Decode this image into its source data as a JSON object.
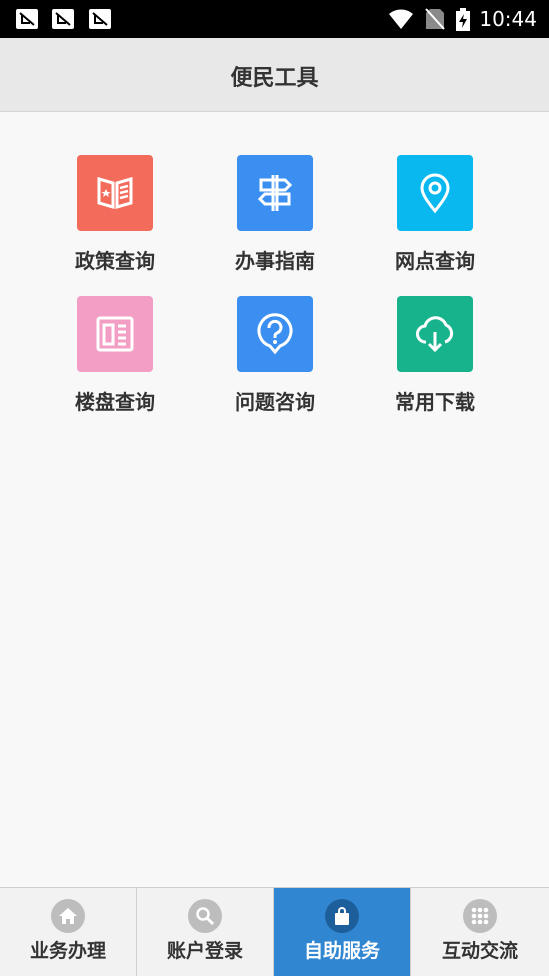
{
  "status_bar": {
    "time": "10:44",
    "notification_icons": [
      "notification-icon",
      "notification-icon",
      "notification-icon"
    ],
    "system_icons": [
      "wifi-icon",
      "no-sim-icon",
      "battery-charging-icon"
    ]
  },
  "header": {
    "title": "便民工具"
  },
  "tools": [
    {
      "label": "政策查询",
      "icon": "policy-book-icon",
      "color": "#f26b5b"
    },
    {
      "label": "办事指南",
      "icon": "signpost-icon",
      "color": "#3b8ff0"
    },
    {
      "label": "网点查询",
      "icon": "location-pin-icon",
      "color": "#0ab8f0"
    },
    {
      "label": "楼盘查询",
      "icon": "building-icon",
      "color": "#f39fc5"
    },
    {
      "label": "问题咨询",
      "icon": "question-bubble-icon",
      "color": "#3b8ff0"
    },
    {
      "label": "常用下载",
      "icon": "cloud-download-icon",
      "color": "#17b38d"
    }
  ],
  "tabs": [
    {
      "label": "业务办理",
      "icon": "home-icon",
      "active": false
    },
    {
      "label": "账户登录",
      "icon": "search-icon",
      "active": false
    },
    {
      "label": "自助服务",
      "icon": "shopping-bag-icon",
      "active": true
    },
    {
      "label": "互动交流",
      "icon": "grid-icon",
      "active": false
    }
  ],
  "colors": {
    "active_tab": "#3186d2",
    "header_bg": "#e8e8e8",
    "status_bar": "#000000"
  }
}
